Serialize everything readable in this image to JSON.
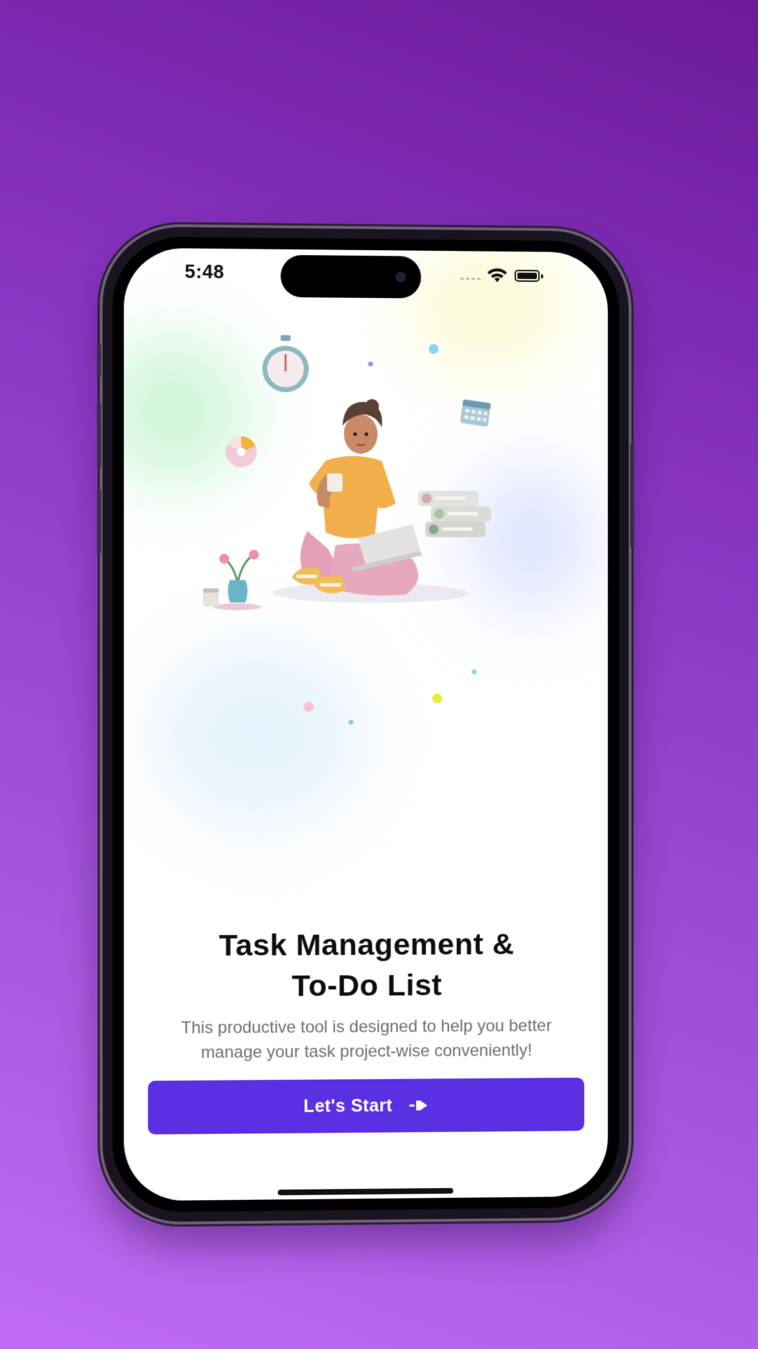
{
  "status_bar": {
    "time": "5:48"
  },
  "onboarding": {
    "title_line1": "Task Management &",
    "title_line2": "To-Do List",
    "subtitle_line1": "This productive tool is designed to help you better",
    "subtitle_line2": "manage your task project-wise conveniently!",
    "cta_label": "Let's Start",
    "cta_icon": "arrow-right-icon"
  },
  "illustration": {
    "subject": "person-with-laptop-illustration",
    "decor_icons": [
      "stopwatch-icon",
      "calendar-icon",
      "pie-chart-icon",
      "plant-vase-icon",
      "task-list-icon"
    ]
  },
  "colors": {
    "background_top": "#6c1a9a",
    "background_bottom": "#c06cf4",
    "primary": "#5b30e2",
    "title": "#0f0f12",
    "subtitle": "#6e6e78"
  }
}
